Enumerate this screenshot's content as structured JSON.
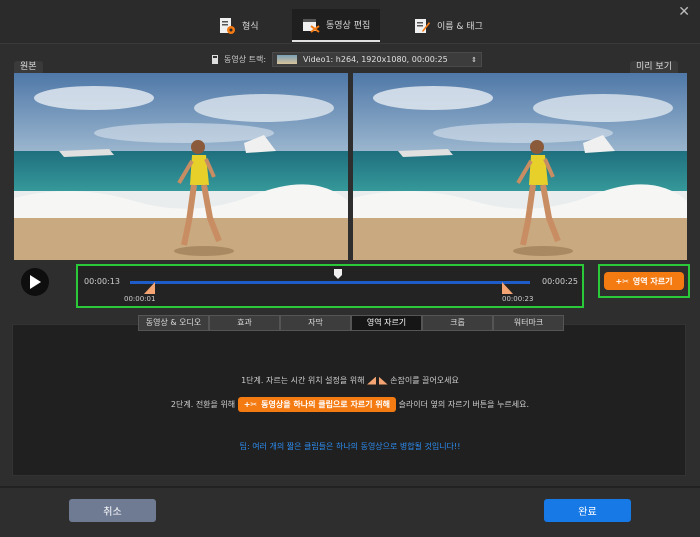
{
  "tabs": [
    {
      "label": "형식"
    },
    {
      "label": "동영상 편집"
    },
    {
      "label": "이름 & 태그"
    }
  ],
  "window": {
    "close": "✕"
  },
  "preview": {
    "original_label": "원본",
    "preview_label": "미리 보기",
    "track_label": "동영상 트랙:",
    "track_value": "Video1: h264, 1920x1080, 00:00:25"
  },
  "timeline": {
    "current_time": "00:00:13",
    "total_time": "00:00:25",
    "start_marker": "00:00:01",
    "end_marker": "00:00:23",
    "playhead_fraction": 0.52
  },
  "cut_button": {
    "label": "영역 자르기"
  },
  "bottom_tabs": [
    {
      "label": "동영상 & 오디오"
    },
    {
      "label": "효과"
    },
    {
      "label": "자막"
    },
    {
      "label": "영역 자르기"
    },
    {
      "label": "크롭"
    },
    {
      "label": "워터마크"
    }
  ],
  "instructions": {
    "step1_before": "1단계. 자르는 시간 위치 설정을 위해",
    "step1_after": "손잡이를 끌어오세요",
    "step2_before": "2단계. 전환을 위해",
    "step2_button": "동영상을 하나의 클립으로 자르기 위해",
    "step2_after": "슬라이더 옆의 자르기 버튼을 누르세요.",
    "tip": "팁: 여러 개의 짧은 클립들은 하나의 동영상으로 병합될 것입니다!!"
  },
  "footer": {
    "cancel": "취소",
    "done": "완료"
  },
  "colors": {
    "accent_orange": "#f47a12",
    "highlight_green": "#29c93a",
    "track_blue": "#1e5cc9",
    "done_blue": "#1679e6",
    "tip_blue": "#2d8cf0"
  }
}
